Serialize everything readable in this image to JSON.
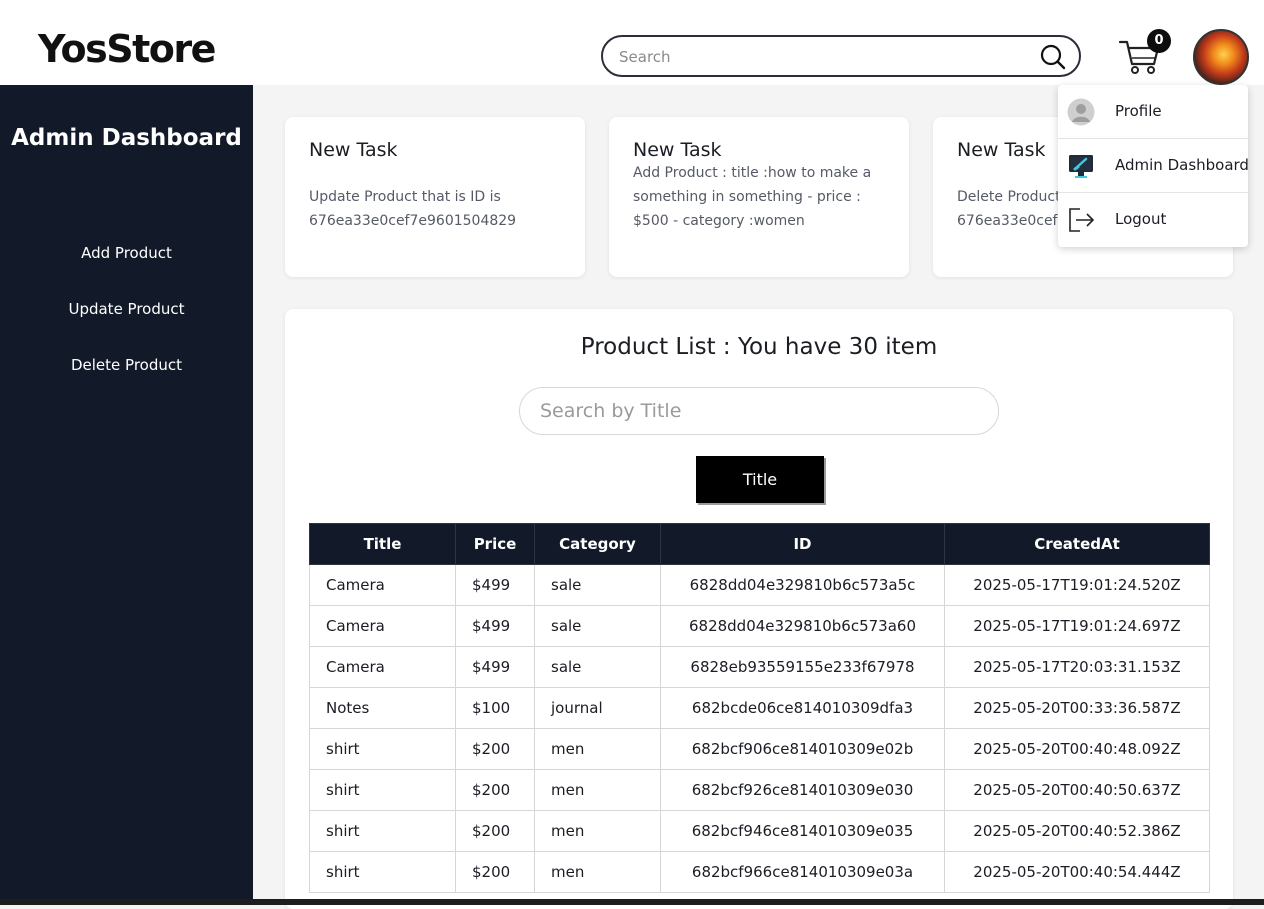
{
  "header": {
    "logo": "YosStore",
    "search_placeholder": "Search",
    "cart_count": "0"
  },
  "sidebar": {
    "title": "Admin Dashboard",
    "items": [
      {
        "label": "Add Product"
      },
      {
        "label": "Update Product"
      },
      {
        "label": "Delete Product"
      }
    ]
  },
  "tasks": [
    {
      "title": "New Task",
      "body": "Update Product that is ID is 676ea33e0cef7e9601504829"
    },
    {
      "title": "New Task",
      "body": "Add Product : title :how to make a something in something - price : $500 - category :women"
    },
    {
      "title": "New Task",
      "body": "Delete Product that is ID is 676ea33e0cef7e9601504829"
    }
  ],
  "dropdown": {
    "items": [
      {
        "label": "Profile",
        "icon": "user-avatar-icon"
      },
      {
        "label": "Admin Dashboard",
        "icon": "dashboard-monitor-icon"
      },
      {
        "label": "Logout",
        "icon": "logout-icon"
      }
    ]
  },
  "products": {
    "heading": "Product List : You have 30 item",
    "search_placeholder": "Search by Title",
    "filter_button": "Title",
    "columns": [
      "Title",
      "Price",
      "Category",
      "ID",
      "CreatedAt"
    ],
    "rows": [
      [
        "Camera",
        "$499",
        "sale",
        "6828dd04e329810b6c573a5c",
        "2025-05-17T19:01:24.520Z"
      ],
      [
        "Camera",
        "$499",
        "sale",
        "6828dd04e329810b6c573a60",
        "2025-05-17T19:01:24.697Z"
      ],
      [
        "Camera",
        "$499",
        "sale",
        "6828eb93559155e233f67978",
        "2025-05-17T20:03:31.153Z"
      ],
      [
        "Notes",
        "$100",
        "journal",
        "682bcde06ce814010309dfa3",
        "2025-05-20T00:33:36.587Z"
      ],
      [
        "shirt",
        "$200",
        "men",
        "682bcf906ce814010309e02b",
        "2025-05-20T00:40:48.092Z"
      ],
      [
        "shirt",
        "$200",
        "men",
        "682bcf926ce814010309e030",
        "2025-05-20T00:40:50.637Z"
      ],
      [
        "shirt",
        "$200",
        "men",
        "682bcf946ce814010309e035",
        "2025-05-20T00:40:52.386Z"
      ],
      [
        "shirt",
        "$200",
        "men",
        "682bcf966ce814010309e03a",
        "2025-05-20T00:40:54.444Z"
      ]
    ]
  },
  "colors": {
    "sidebar_bg": "#121a2a",
    "page_bg": "#f4f4f5",
    "button_bg": "#000000"
  }
}
